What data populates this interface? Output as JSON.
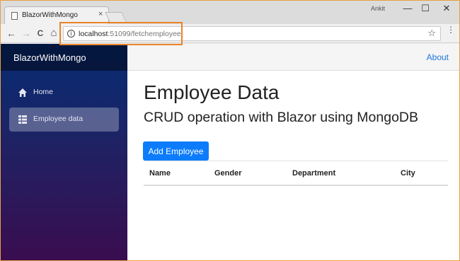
{
  "browser": {
    "tab_title": "BlazorWithMongo",
    "tab_close": "×",
    "user_name": "Ankit",
    "window_controls": {
      "minimize": "—",
      "maximize": "☐",
      "close": "✕"
    },
    "nav": {
      "back": "←",
      "forward": "→",
      "reload": "C",
      "home": "⌂"
    },
    "info_icon": "i",
    "url_host": "localhost",
    "url_path": ":51099/fetchemployee",
    "star_icon": "☆",
    "menu_icon": "⋮",
    "icons": [
      "page-icon",
      "back-arrow-icon",
      "forward-arrow-icon",
      "reload-icon",
      "home-icon",
      "info-icon",
      "star-icon",
      "menu-dots-icon"
    ]
  },
  "app": {
    "brand": "BlazorWithMongo",
    "about_link": "About",
    "sidebar": {
      "items": [
        {
          "label": "Home",
          "icon": "home-icon",
          "active": false
        },
        {
          "label": "Employee data",
          "icon": "list-icon",
          "active": true
        }
      ]
    },
    "heading": "Employee Data",
    "subheading": "CRUD operation with Blazor using MongoDB",
    "add_button": "Add Employee",
    "table": {
      "columns": [
        "Name",
        "Gender",
        "Department",
        "City"
      ],
      "rows": []
    },
    "colors": {
      "accent": "#0c7cfb",
      "link": "#1d75d8",
      "highlight": "#e8832a"
    }
  }
}
